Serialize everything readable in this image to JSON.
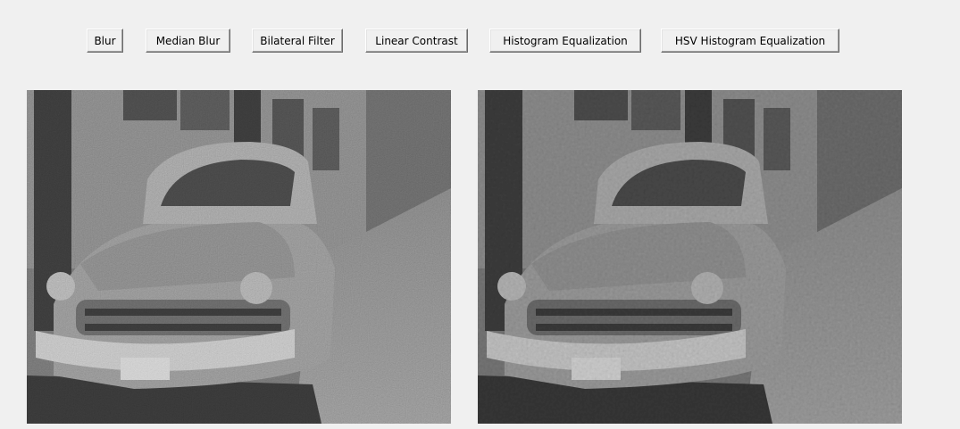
{
  "toolbar": {
    "buttons": [
      {
        "label": "Blur"
      },
      {
        "label": "Median Blur"
      },
      {
        "label": "Bilateral Filter"
      },
      {
        "label": "Linear Contrast"
      },
      {
        "label": "Histogram Equalization"
      },
      {
        "label": "HSV Histogram Equalization"
      }
    ]
  },
  "images": {
    "original": {
      "subject": "vintage car on street (noisy grayscale)"
    },
    "processed": {
      "subject": "vintage car on street (filtered grayscale)"
    }
  }
}
